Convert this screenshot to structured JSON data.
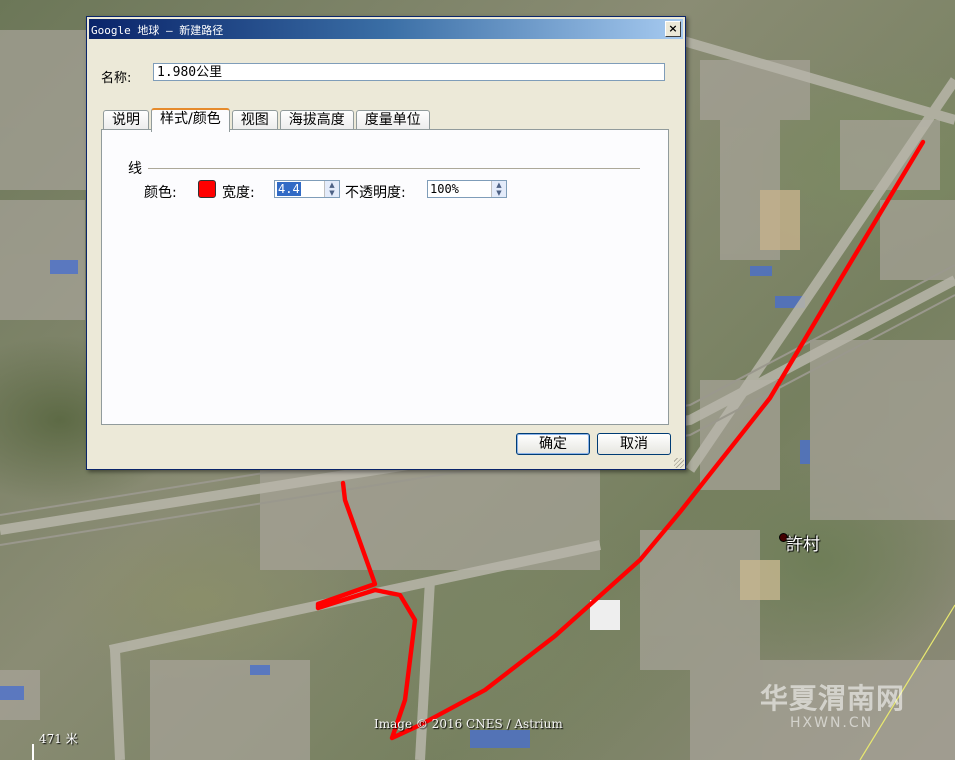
{
  "dialog": {
    "title": "Google 地球 – 新建路径",
    "close_glyph": "×",
    "name_label": "名称:",
    "name_value": "1.980公里",
    "tabs": [
      {
        "label": "说明",
        "active": false
      },
      {
        "label": "样式/颜色",
        "active": true
      },
      {
        "label": "视图",
        "active": false
      },
      {
        "label": "海拔高度",
        "active": false
      },
      {
        "label": "度量单位",
        "active": false
      }
    ],
    "line_group_label": "线",
    "color_label": "颜色:",
    "line_color": "#ff0000",
    "width_label": "宽度:",
    "width_value": "4.4",
    "opacity_label": "不透明度:",
    "opacity_value": "100%",
    "ok_button": "确定",
    "cancel_button": "取消"
  },
  "map": {
    "place_label": "許村",
    "attribution": "Image © 2016 CNES / Astrium",
    "scale_label": "471 米",
    "watermark": "华夏渭南网",
    "watermark_sub": "HXWN.CN",
    "path_color": "#ff0000",
    "icons": [
      "scale-bar-icon",
      "place-marker-icon"
    ]
  }
}
